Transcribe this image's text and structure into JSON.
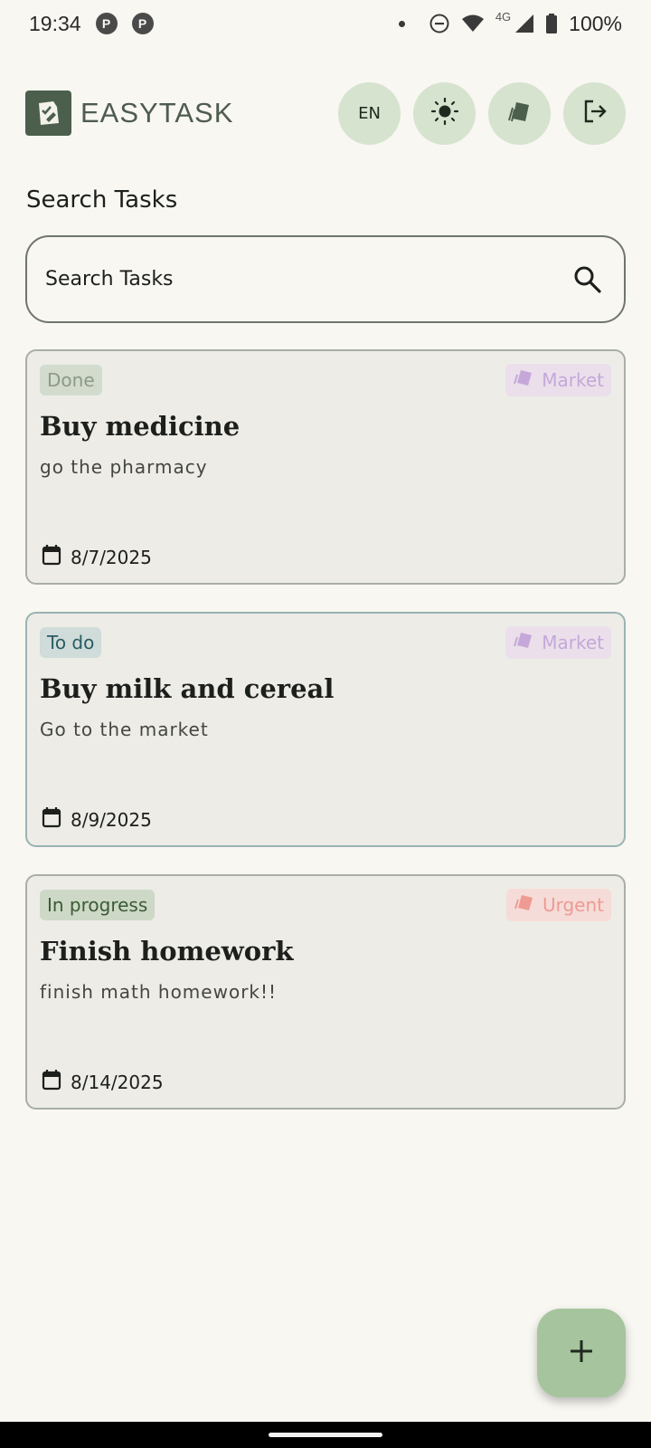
{
  "status_bar": {
    "time": "19:34",
    "network": "4G",
    "battery": "100%",
    "notification_icons": [
      "P",
      "P"
    ]
  },
  "header": {
    "brand": "EASYTASK",
    "lang_label": "EN",
    "icons": [
      "brightness-icon",
      "tags-icon",
      "logout-icon"
    ]
  },
  "search": {
    "title": "Search Tasks",
    "placeholder": "Search Tasks"
  },
  "tasks": [
    {
      "status": "Done",
      "tag": "Market",
      "title": "Buy medicine",
      "description": "go the pharmacy",
      "date": "8/7/2025"
    },
    {
      "status": "To do",
      "tag": "Market",
      "title": "Buy milk and cereal",
      "description": "Go to the market",
      "date": "8/9/2025"
    },
    {
      "status": "In progress",
      "tag": "Urgent",
      "title": "Finish homework",
      "description": "finish math homework!!",
      "date": "8/14/2025"
    }
  ],
  "colors": {
    "accent": "#a6c49d",
    "header_button": "#d6e3cf",
    "tag_market": "#c5a8d9",
    "tag_urgent": "#ef9a92"
  }
}
